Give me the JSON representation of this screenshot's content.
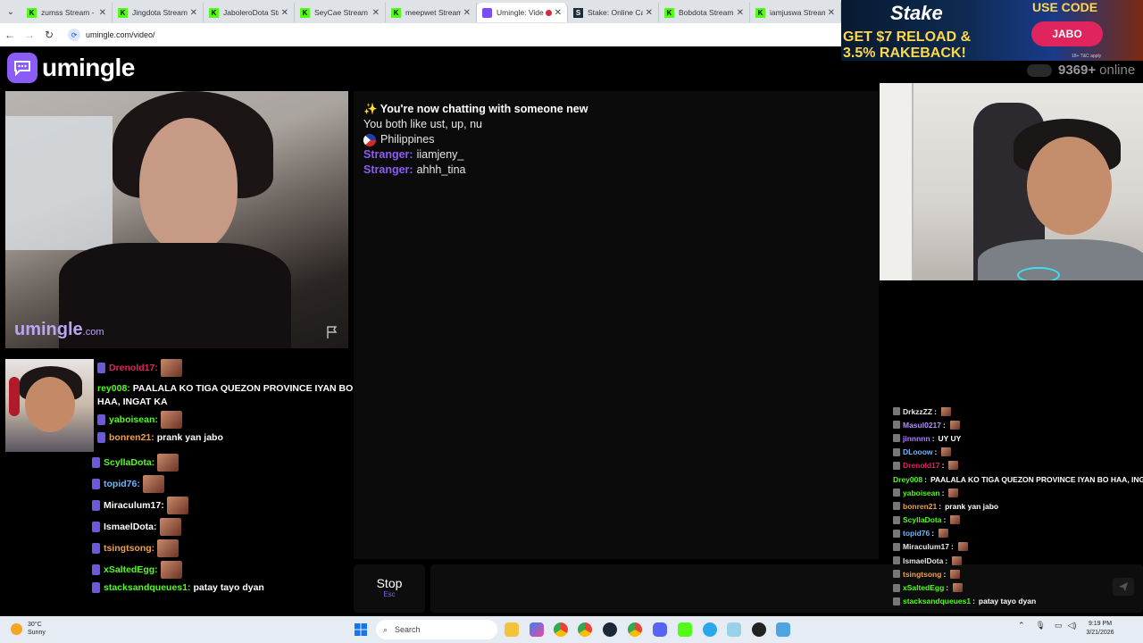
{
  "browser": {
    "tabs": [
      {
        "title": "zumss Stream - K",
        "type": "kick"
      },
      {
        "title": "Jingdota Stream",
        "type": "kick"
      },
      {
        "title": "JaboleroDota Str",
        "type": "kick"
      },
      {
        "title": "SeyCae Stream",
        "type": "kick"
      },
      {
        "title": "meepwet Stream",
        "type": "kick"
      },
      {
        "title": "Umingle: Vide",
        "type": "umingle"
      },
      {
        "title": "Stake: Online Cas",
        "type": "stake"
      },
      {
        "title": "Bobdota Stream",
        "type": "kick"
      },
      {
        "title": "iamjuswa Stream",
        "type": "kick"
      }
    ],
    "url": "umingle.com/video/"
  },
  "ad": {
    "logo": "Stake",
    "offer_line1": "GET $7 RELOAD &",
    "offer_line2": "3.5% RAKEBACK!",
    "use_code_label": "USE CODE",
    "code": "JABO",
    "fine_print": "18+ T&C apply"
  },
  "site": {
    "logo_text": "umingle",
    "online_count": "9369+",
    "online_label": "online",
    "watermark": "umingle",
    "watermark_suffix": ".com"
  },
  "chat": {
    "system_title": "✨ You're now chatting with someone new",
    "common_interests": "You both like ust, up, nu",
    "country": "Philippines",
    "messages": [
      {
        "who": "Stranger:",
        "text": "iiamjeny_"
      },
      {
        "who": "Stranger:",
        "text": "ahhh_tina"
      }
    ],
    "stop_label": "Stop",
    "stop_hint": "Esc",
    "input_placeholder": ""
  },
  "overlay_chat": {
    "rows": [
      {
        "user": "Drenold17:",
        "text": "",
        "emote": true,
        "color": "#e0245e"
      },
      {
        "user": "rey008:",
        "text": "PAALALA KO TIGA QUEZON PROVINCE IYAN BO HAA, INGAT KA",
        "emote": false,
        "color": "#53fc18"
      },
      {
        "user": "yaboisean:",
        "text": "",
        "emote": true,
        "color": "#53fc18"
      },
      {
        "user": "bonren21:",
        "text": "prank yan jabo",
        "emote": false,
        "color": "#f0a14a"
      },
      {
        "user": "ScyllaDota:",
        "text": "",
        "emote": true,
        "color": "#53fc18"
      },
      {
        "user": "topid76:",
        "text": "",
        "emote": true,
        "color": "#6cb8ff"
      },
      {
        "user": "Miraculum17:",
        "text": "",
        "emote": true,
        "color": "#fff"
      },
      {
        "user": "IsmaelDota:",
        "text": "",
        "emote": true,
        "color": "#fff"
      },
      {
        "user": "tsingtsong:",
        "text": "",
        "emote": true,
        "color": "#f0a14a"
      },
      {
        "user": "xSaltedEgg:",
        "text": "",
        "emote": true,
        "color": "#53fc18"
      },
      {
        "user": "stacksandqueues1:",
        "text": "patay tayo dyan",
        "emote": false,
        "color": "#53fc18"
      }
    ]
  },
  "stream_chat": {
    "rows": [
      {
        "user": "DrkzzZZ",
        "text": "",
        "color": "#e8e8e8"
      },
      {
        "user": "Masul0217",
        "text": "",
        "color": "#b58cff"
      },
      {
        "user": "jinnnnn",
        "text": "UY UY",
        "color": "#b47cff"
      },
      {
        "user": "DLooow",
        "text": "",
        "color": "#6cb8ff"
      },
      {
        "user": "Drenold17",
        "text": "",
        "color": "#e0245e"
      },
      {
        "user": "Drey008",
        "text": "PAALALA KO TIGA QUEZON PROVINCE IYAN BO HAA, INGAT KA",
        "color": "#53fc18"
      },
      {
        "user": "yaboisean",
        "text": "",
        "color": "#53fc18"
      },
      {
        "user": "bonren21",
        "text": "prank yan jabo",
        "color": "#f0a14a"
      },
      {
        "user": "ScyllaDota",
        "text": "",
        "color": "#53fc18"
      },
      {
        "user": "topid76",
        "text": "",
        "color": "#6cb8ff"
      },
      {
        "user": "Miraculum17",
        "text": "",
        "color": "#e8e8e8"
      },
      {
        "user": "IsmaelDota",
        "text": "",
        "color": "#e8e8e8"
      },
      {
        "user": "tsingtsong",
        "text": "",
        "color": "#f0a14a"
      },
      {
        "user": "xSaltedEgg",
        "text": "",
        "color": "#53fc18"
      },
      {
        "user": "stacksandqueues1",
        "text": "patay tayo dyan",
        "color": "#53fc18"
      }
    ]
  },
  "taskbar": {
    "temperature": "30°C",
    "condition": "Sunny",
    "search_placeholder": "Search",
    "time": "9:19 PM",
    "date": "3/21/2026"
  },
  "colors": {
    "accent": "#8b5cf6",
    "kick_green": "#53fc18",
    "stake_pink": "#e0245e"
  }
}
